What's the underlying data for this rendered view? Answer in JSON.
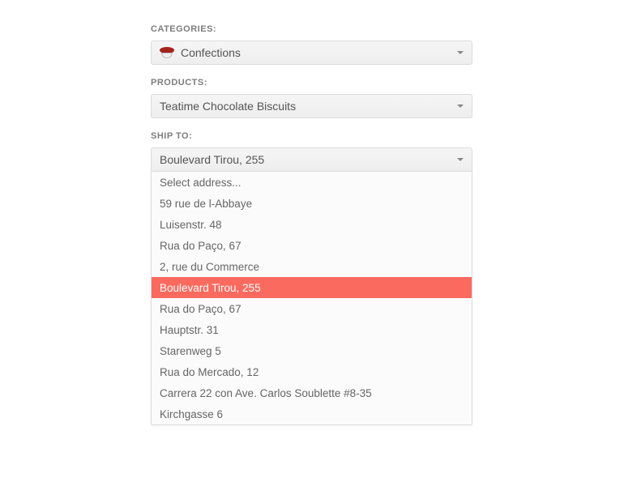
{
  "categories": {
    "label": "CATEGORIES:",
    "selected": "Confections",
    "icon": "confections-icon"
  },
  "products": {
    "label": "PRODUCTS:",
    "selected": "Teatime Chocolate Biscuits"
  },
  "shipto": {
    "label": "SHIP TO:",
    "selected": "Boulevard Tirou, 255",
    "options": [
      {
        "label": "Select address...",
        "selected": false
      },
      {
        "label": "59 rue de l-Abbaye",
        "selected": false
      },
      {
        "label": "Luisenstr. 48",
        "selected": false
      },
      {
        "label": "Rua do Paço, 67",
        "selected": false
      },
      {
        "label": "2, rue du Commerce",
        "selected": false
      },
      {
        "label": "Boulevard Tirou, 255",
        "selected": true
      },
      {
        "label": "Rua do Paço, 67",
        "selected": false
      },
      {
        "label": "Hauptstr. 31",
        "selected": false
      },
      {
        "label": "Starenweg 5",
        "selected": false
      },
      {
        "label": "Rua do Mercado, 12",
        "selected": false
      },
      {
        "label": "Carrera 22 con Ave. Carlos Soublette #8-35",
        "selected": false
      },
      {
        "label": "Kirchgasse 6",
        "selected": false
      }
    ]
  }
}
